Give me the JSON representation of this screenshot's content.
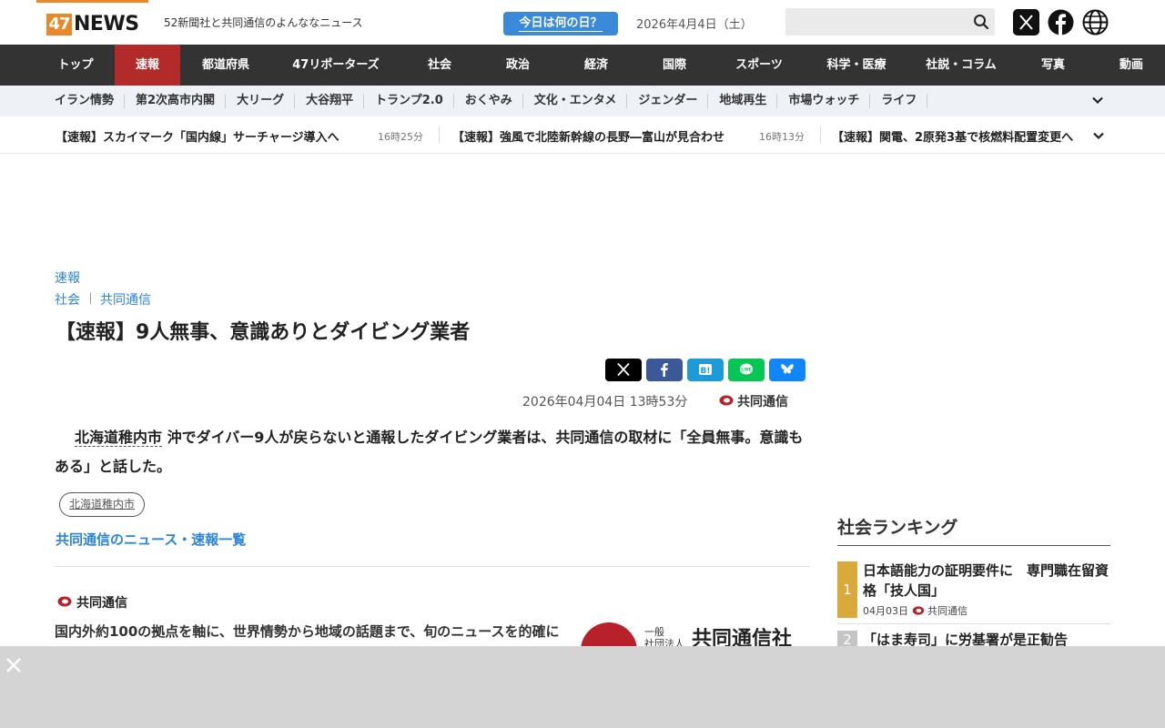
{
  "header": {
    "logo_number": "47",
    "logo_text": "NEWS",
    "tagline": "52新聞社と共同通信のよんななニュース",
    "today_button": "今日は何の日？",
    "date": "2026年4月4日（土）",
    "search_placeholder": ""
  },
  "main_nav": [
    {
      "label": "トップ"
    },
    {
      "label": "速報",
      "active": true
    },
    {
      "label": "都道府県"
    },
    {
      "label": "47リポーターズ"
    },
    {
      "label": "社会"
    },
    {
      "label": "政治"
    },
    {
      "label": "経済"
    },
    {
      "label": "国際"
    },
    {
      "label": "スポーツ"
    },
    {
      "label": "科学・医療"
    },
    {
      "label": "社説・コラム"
    },
    {
      "label": "写真"
    },
    {
      "label": "動画"
    }
  ],
  "sub_nav": [
    {
      "label": "イラン情勢"
    },
    {
      "label": "第2次高市内閣"
    },
    {
      "label": "大リーグ"
    },
    {
      "label": "大谷翔平"
    },
    {
      "label": "トランプ2.0"
    },
    {
      "label": "おくやみ"
    },
    {
      "label": "文化・エンタメ"
    },
    {
      "label": "ジェンダー"
    },
    {
      "label": "地域再生"
    },
    {
      "label": "市場ウォッチ"
    },
    {
      "label": "ライフ"
    }
  ],
  "ticker": [
    {
      "title": "【速報】スカイマーク「国内線」サーチャージ導入へ",
      "time": "16時25分"
    },
    {
      "title": "【速報】強風で北陸新幹線の長野―富山が見合わせ",
      "time": "16時13分"
    },
    {
      "title": "【速報】関電、2原発3基で核燃料配置変更へ",
      "time": ""
    }
  ],
  "article": {
    "section": "速報",
    "category": "社会",
    "source_tag": "共同通信",
    "title": "【速報】9人無事、意識ありとダイビング業者",
    "date": "2026年04月04日",
    "time": "13時53分",
    "source": "共同通信",
    "body_place": "北海道稚内市",
    "body_rest": " 沖でダイバー9人が戻らないと通報したダイビング業者は、共同通信の取材に「全員無事。意識もある」と話した。",
    "tag": "北海道稚内市",
    "list_link": "共同通信のニュース・速報一覧"
  },
  "profile": {
    "name": "共同通信",
    "description": "国内外約100の拠点を軸に、世界情勢から地域の話題まで、旬のニュースを的確にいち早く届けます。",
    "logo_small_1": "一般",
    "logo_small_2": "社団法人",
    "logo_big": "共同通信社"
  },
  "ranking": {
    "title": "社会ランキング",
    "items": [
      {
        "rank": "1",
        "title": "日本語能力の証明要件に　専門職在留資格「技人国」",
        "date": "04月03日",
        "source": "共同通信",
        "color": "#d9aa3a"
      },
      {
        "rank": "2",
        "title": "「はま寿司」に労基署が是正勧告",
        "color": "#c4c4c4"
      }
    ]
  },
  "colors": {
    "accent": "#e8882a",
    "nav_bg": "#333333",
    "nav_active": "#b22a2a",
    "link": "#2b84d8"
  }
}
